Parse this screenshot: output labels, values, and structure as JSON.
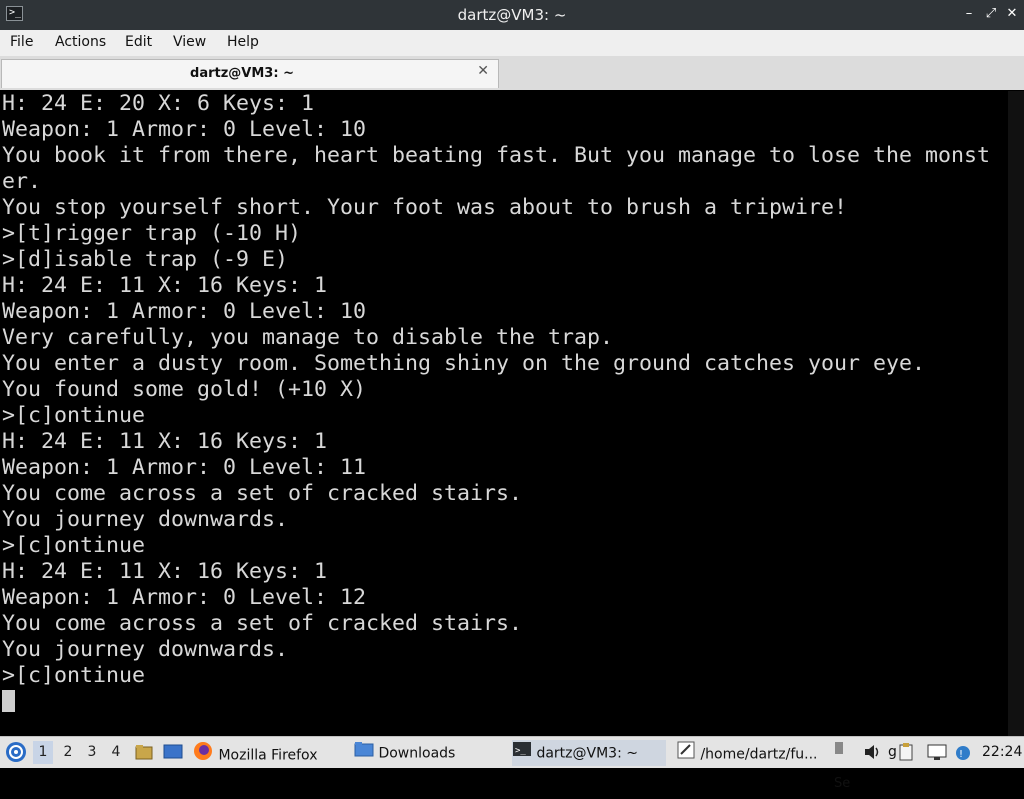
{
  "window": {
    "title": "dartz@VM3: ~",
    "minimize_glyph": "–",
    "maximize_glyph": "⤢",
    "close_glyph": "✕"
  },
  "menu": [
    "File",
    "Actions",
    "Edit",
    "View",
    "Help"
  ],
  "tab": {
    "label": "dartz@VM3: ~",
    "close_glyph": "✕"
  },
  "terminal": {
    "lines": [
      "H: 24 E: 20 X: 6 Keys: 1",
      "Weapon: 1 Armor: 0 Level: 10",
      "You book it from there, heart beating fast. But you manage to lose the monst",
      "er.",
      "You stop yourself short. Your foot was about to brush a tripwire!",
      ">[t]rigger trap (-10 H)",
      ">[d]isable trap (-9 E)",
      "H: 24 E: 11 X: 16 Keys: 1",
      "Weapon: 1 Armor: 0 Level: 10",
      "Very carefully, you manage to disable the trap.",
      "You enter a dusty room. Something shiny on the ground catches your eye.",
      "You found some gold! (+10 X)",
      ">[c]ontinue",
      "H: 24 E: 11 X: 16 Keys: 1",
      "Weapon: 1 Armor: 0 Level: 11",
      "You come across a set of cracked stairs.",
      "You journey downwards.",
      ">[c]ontinue",
      "H: 24 E: 11 X: 16 Keys: 1",
      "Weapon: 1 Armor: 0 Level: 12",
      "You come across a set of cracked stairs.",
      "You journey downwards.",
      ">[c]ontinue"
    ]
  },
  "taskbar": {
    "workspaces": [
      "1",
      "2",
      "3",
      "4"
    ],
    "active_workspace": "1",
    "firefox_label": "Mozilla Firefox",
    "downloads_label": "Downloads",
    "terminal_label": "dartz@VM3: ~",
    "editor_label": "/home/dartz/fu...",
    "tray_se": "Se",
    "tray_g": "g",
    "clock": "22:24"
  }
}
